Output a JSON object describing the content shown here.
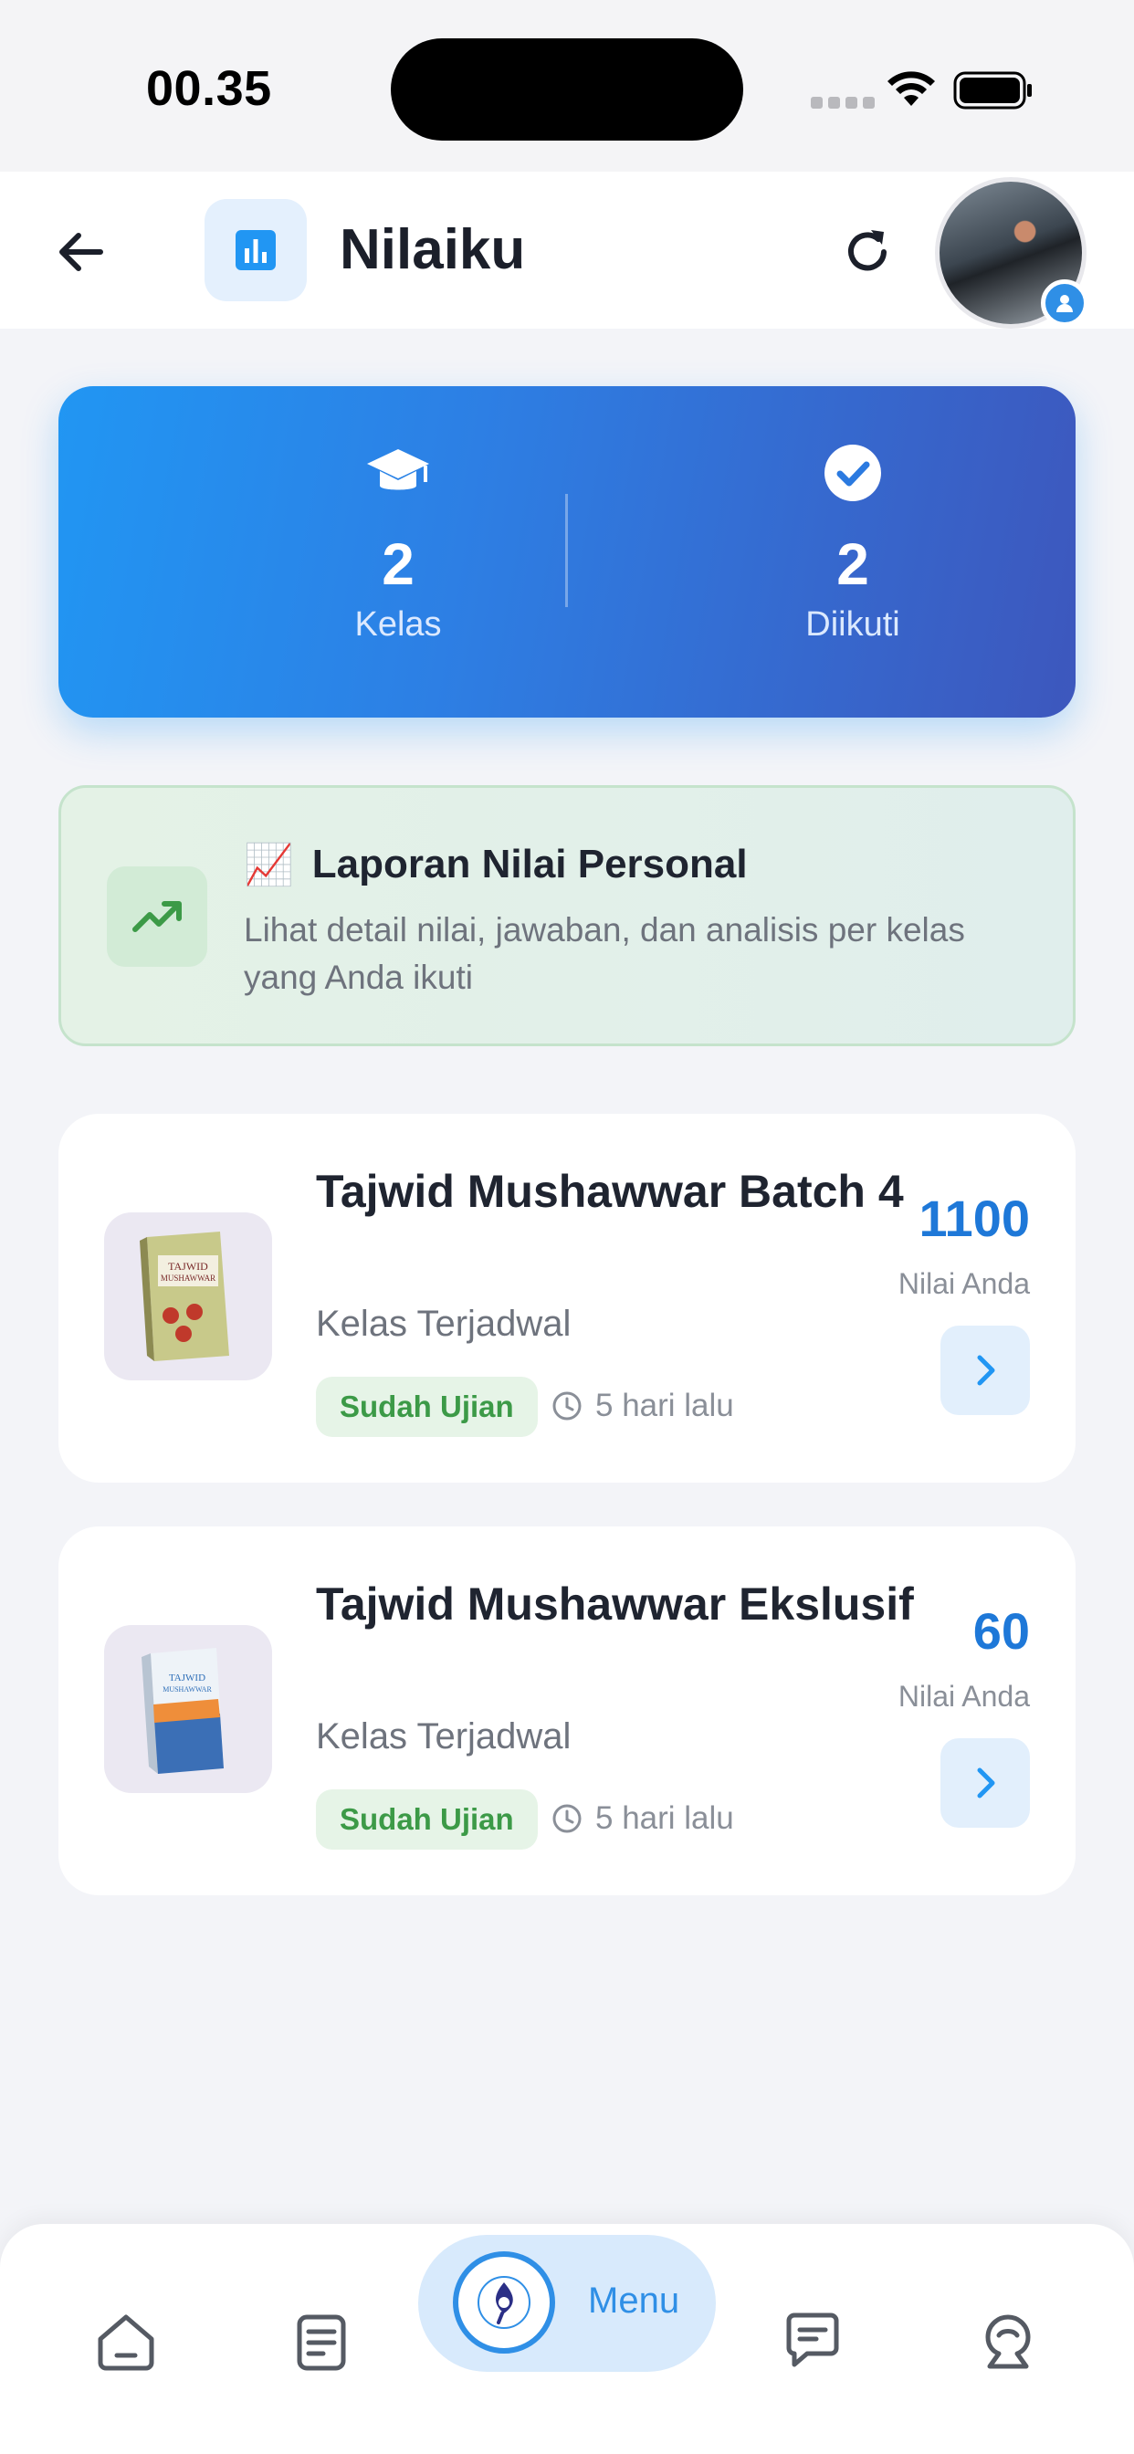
{
  "status_bar": {
    "time": "00.35"
  },
  "header": {
    "title": "Nilaiku"
  },
  "stats": {
    "kelas": {
      "value": "2",
      "label": "Kelas"
    },
    "diikuti": {
      "value": "2",
      "label": "Diikuti"
    }
  },
  "report": {
    "emoji": "📈",
    "title": "Laporan Nilai Personal",
    "description": "Lihat detail nilai, jawaban, dan analisis per kelas yang Anda ikuti"
  },
  "classes": [
    {
      "name": "Tajwid Mushawwar Batch 4",
      "type": "Kelas Terjadwal",
      "badge": "Sudah Ujian",
      "time": "5 hari lalu",
      "score": "1100",
      "score_label": "Nilai Anda"
    },
    {
      "name": "Tajwid Mushawwar Ekslusif",
      "type": "Kelas Terjadwal",
      "badge": "Sudah Ujian",
      "time": "5 hari lalu",
      "score": "60",
      "score_label": "Nilai Anda"
    }
  ],
  "nav": {
    "items": [
      "home-icon",
      "notes-icon",
      "menu",
      "chat-icon",
      "profile-icon"
    ],
    "menu_label": "Menu"
  },
  "colors": {
    "accent": "#2196f3",
    "gradient_end": "#3d57bd",
    "score": "#1e78d8",
    "success": "#3c9a47"
  }
}
